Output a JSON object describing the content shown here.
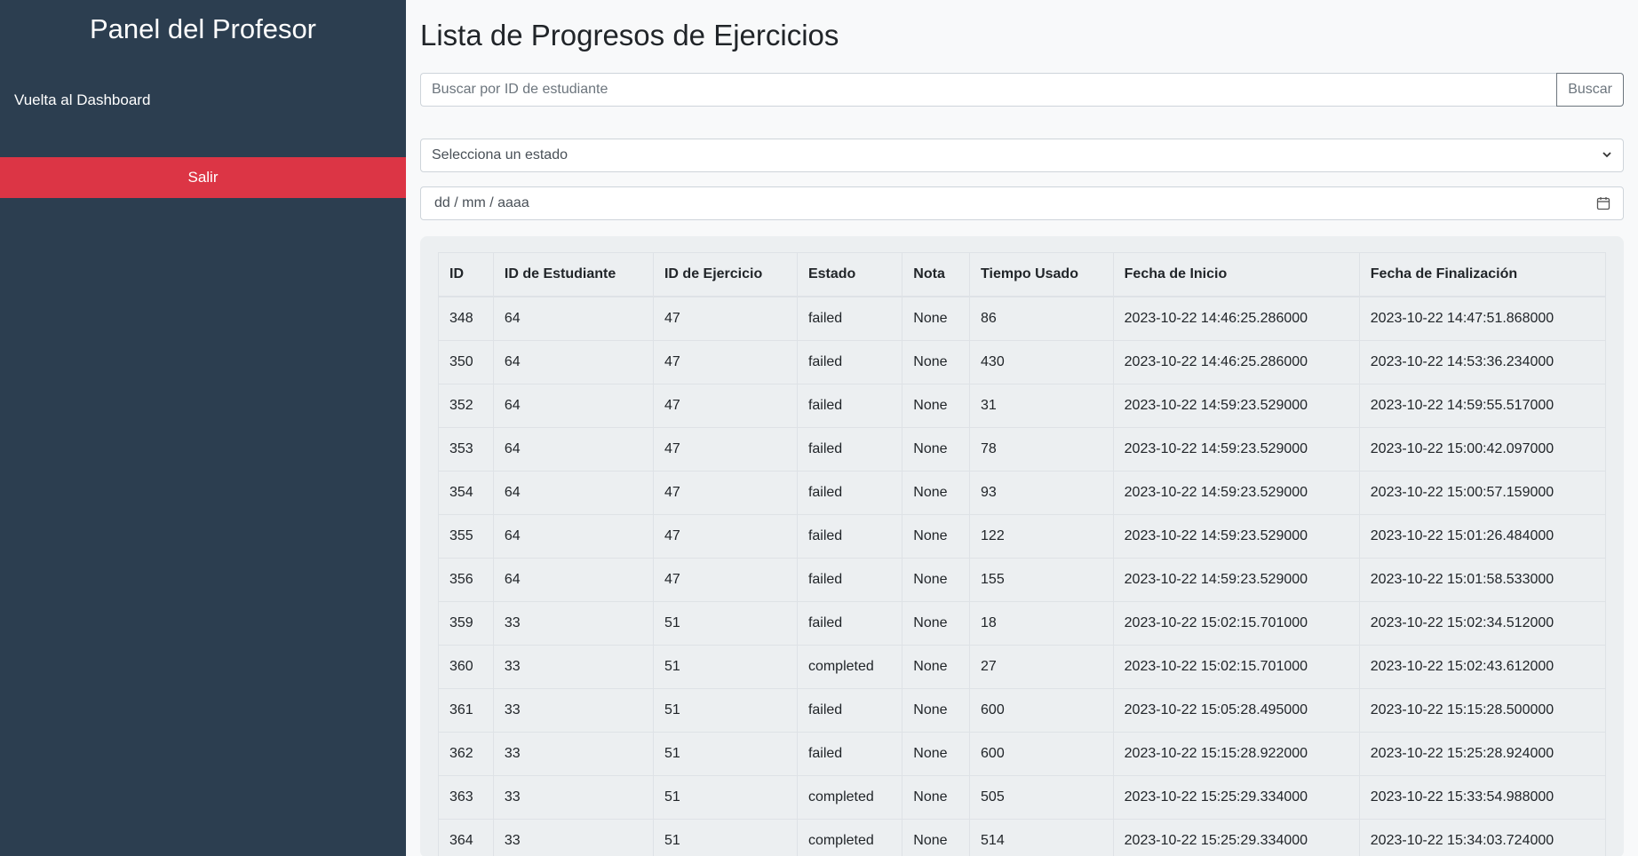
{
  "sidebar": {
    "title": "Panel del Profesor",
    "dashboard_link": "Vuelta al Dashboard",
    "logout_label": "Salir"
  },
  "main": {
    "title": "Lista de Progresos de Ejercicios",
    "search": {
      "placeholder": "Buscar por ID de estudiante",
      "value": "",
      "button_label": "Buscar"
    },
    "status_select": {
      "selected": "Selecciona un estado"
    },
    "date_filter": {
      "placeholder": "dd / mm / aaaa"
    },
    "table": {
      "columns": [
        "ID",
        "ID de Estudiante",
        "ID de Ejercicio",
        "Estado",
        "Nota",
        "Tiempo Usado",
        "Fecha de Inicio",
        "Fecha de Finalización"
      ],
      "rows": [
        [
          "348",
          "64",
          "47",
          "failed",
          "None",
          "86",
          "2023-10-22 14:46:25.286000",
          "2023-10-22 14:47:51.868000"
        ],
        [
          "350",
          "64",
          "47",
          "failed",
          "None",
          "430",
          "2023-10-22 14:46:25.286000",
          "2023-10-22 14:53:36.234000"
        ],
        [
          "352",
          "64",
          "47",
          "failed",
          "None",
          "31",
          "2023-10-22 14:59:23.529000",
          "2023-10-22 14:59:55.517000"
        ],
        [
          "353",
          "64",
          "47",
          "failed",
          "None",
          "78",
          "2023-10-22 14:59:23.529000",
          "2023-10-22 15:00:42.097000"
        ],
        [
          "354",
          "64",
          "47",
          "failed",
          "None",
          "93",
          "2023-10-22 14:59:23.529000",
          "2023-10-22 15:00:57.159000"
        ],
        [
          "355",
          "64",
          "47",
          "failed",
          "None",
          "122",
          "2023-10-22 14:59:23.529000",
          "2023-10-22 15:01:26.484000"
        ],
        [
          "356",
          "64",
          "47",
          "failed",
          "None",
          "155",
          "2023-10-22 14:59:23.529000",
          "2023-10-22 15:01:58.533000"
        ],
        [
          "359",
          "33",
          "51",
          "failed",
          "None",
          "18",
          "2023-10-22 15:02:15.701000",
          "2023-10-22 15:02:34.512000"
        ],
        [
          "360",
          "33",
          "51",
          "completed",
          "None",
          "27",
          "2023-10-22 15:02:15.701000",
          "2023-10-22 15:02:43.612000"
        ],
        [
          "361",
          "33",
          "51",
          "failed",
          "None",
          "600",
          "2023-10-22 15:05:28.495000",
          "2023-10-22 15:15:28.500000"
        ],
        [
          "362",
          "33",
          "51",
          "failed",
          "None",
          "600",
          "2023-10-22 15:15:28.922000",
          "2023-10-22 15:25:28.924000"
        ],
        [
          "363",
          "33",
          "51",
          "completed",
          "None",
          "505",
          "2023-10-22 15:25:29.334000",
          "2023-10-22 15:33:54.988000"
        ],
        [
          "364",
          "33",
          "51",
          "completed",
          "None",
          "514",
          "2023-10-22 15:25:29.334000",
          "2023-10-22 15:34:03.724000"
        ]
      ]
    }
  },
  "colors": {
    "sidebar_bg": "#2c3e50",
    "logout_bg": "#dc3545",
    "page_bg": "#f8f9fa",
    "table_card_bg": "#eceff1"
  }
}
